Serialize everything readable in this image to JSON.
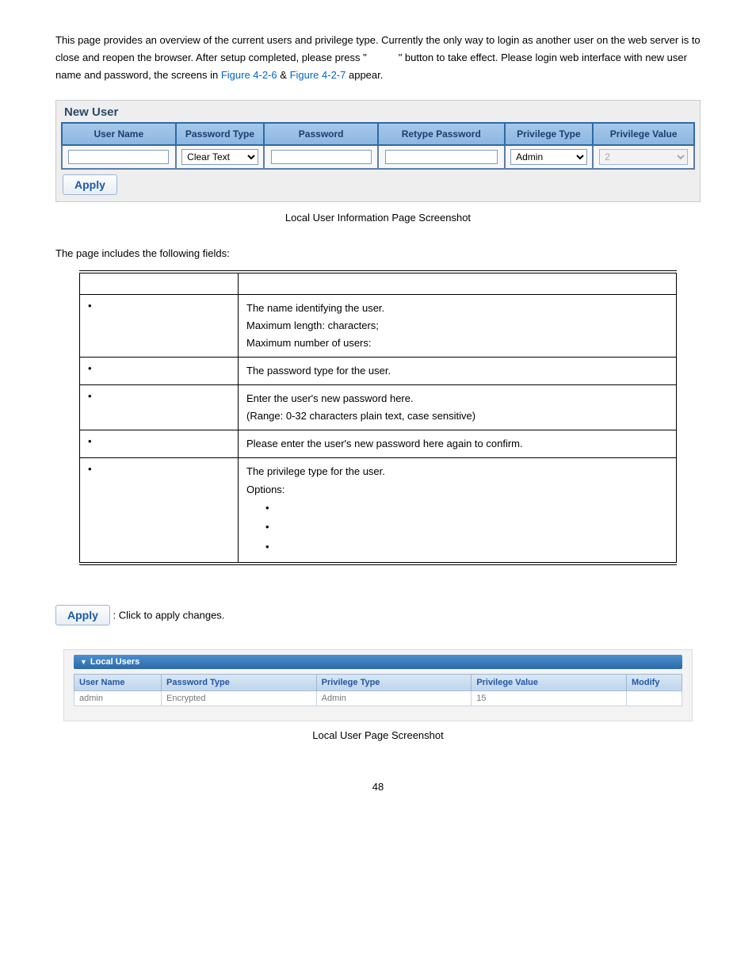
{
  "intro": {
    "line1_a": "This page provides an overview of the current users and privilege type. Currently the only way to login as another user on the web",
    "line2_a": "server is to close and reopen the browser. After setup completed, please press \"",
    "line2_b": "\" button to take effect. Please login web",
    "line3_a": "interface with new user name and password, the screens in ",
    "fig1": "Figure 4-2-6",
    "amp": " & ",
    "fig2": "Figure 4-2-7",
    "line3_b": " appear."
  },
  "new_user_form": {
    "title": "New User",
    "headers": {
      "user_name": "User Name",
      "password_type": "Password Type",
      "password": "Password",
      "retype_password": "Retype Password",
      "priv_type": "Privilege Type",
      "priv_value": "Privilege Value"
    },
    "values": {
      "password_type": "Clear Text",
      "priv_type": "Admin",
      "priv_value": "2"
    },
    "apply_label": "Apply"
  },
  "caption1": "Local User Information Page Screenshot",
  "fields_heading": "The page includes the following fields:",
  "spec": {
    "rows": [
      {
        "desc_lines": [
          "The name identifying the user.",
          "Maximum length:       characters;",
          "Maximum number of users:"
        ]
      },
      {
        "desc_lines": [
          "The password type for the user."
        ]
      },
      {
        "desc_lines": [
          "Enter the user's new password here.",
          "(Range: 0-32 characters plain text, case sensitive)"
        ]
      },
      {
        "desc_lines": [
          "Please enter the user's new password here again to confirm."
        ]
      },
      {
        "desc_lines": [
          "The privilege type for the user.",
          "Options:"
        ],
        "sub_bullets": 3
      }
    ]
  },
  "buttons": {
    "apply_label": "Apply",
    "apply_desc": ": Click to apply changes."
  },
  "local_users": {
    "panel_title": "Local Users",
    "headers": {
      "user_name": "User Name",
      "password_type": "Password Type",
      "priv_type": "Privilege Type",
      "priv_value": "Privilege Value",
      "modify": "Modify"
    },
    "row": {
      "user_name": "admin",
      "password_type": "Encrypted",
      "priv_type": "Admin",
      "priv_value": "15"
    }
  },
  "caption2": "Local User Page Screenshot",
  "page_number": "48"
}
